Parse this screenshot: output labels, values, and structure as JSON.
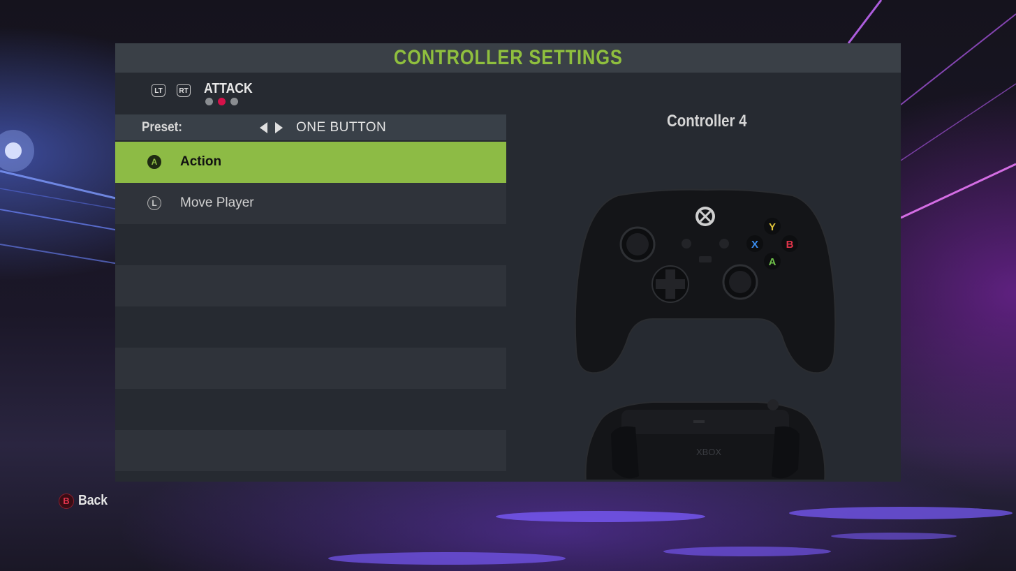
{
  "header": {
    "title": "CONTROLLER SETTINGS"
  },
  "tabs": {
    "left_bumper": "LT",
    "right_bumper": "RT",
    "current": "ATTACK",
    "page_count": 3,
    "active_page": 2
  },
  "preset": {
    "label": "Preset:",
    "value": "ONE BUTTON"
  },
  "mappings": [
    {
      "button_glyph": "A",
      "action": "Action",
      "selected": true
    },
    {
      "button_glyph": "L",
      "action": "Move Player",
      "selected": false
    }
  ],
  "controller": {
    "label": "Controller 4",
    "face_buttons": [
      "Y",
      "X",
      "B",
      "A"
    ],
    "back_brand": "XBOX"
  },
  "footer": {
    "back_glyph": "B",
    "back_label": "Back"
  },
  "colors": {
    "accent_green": "#8dbb45",
    "title_green": "#8fbf3e",
    "active_dot": "#d5124a",
    "back_red": "#e2344d"
  }
}
